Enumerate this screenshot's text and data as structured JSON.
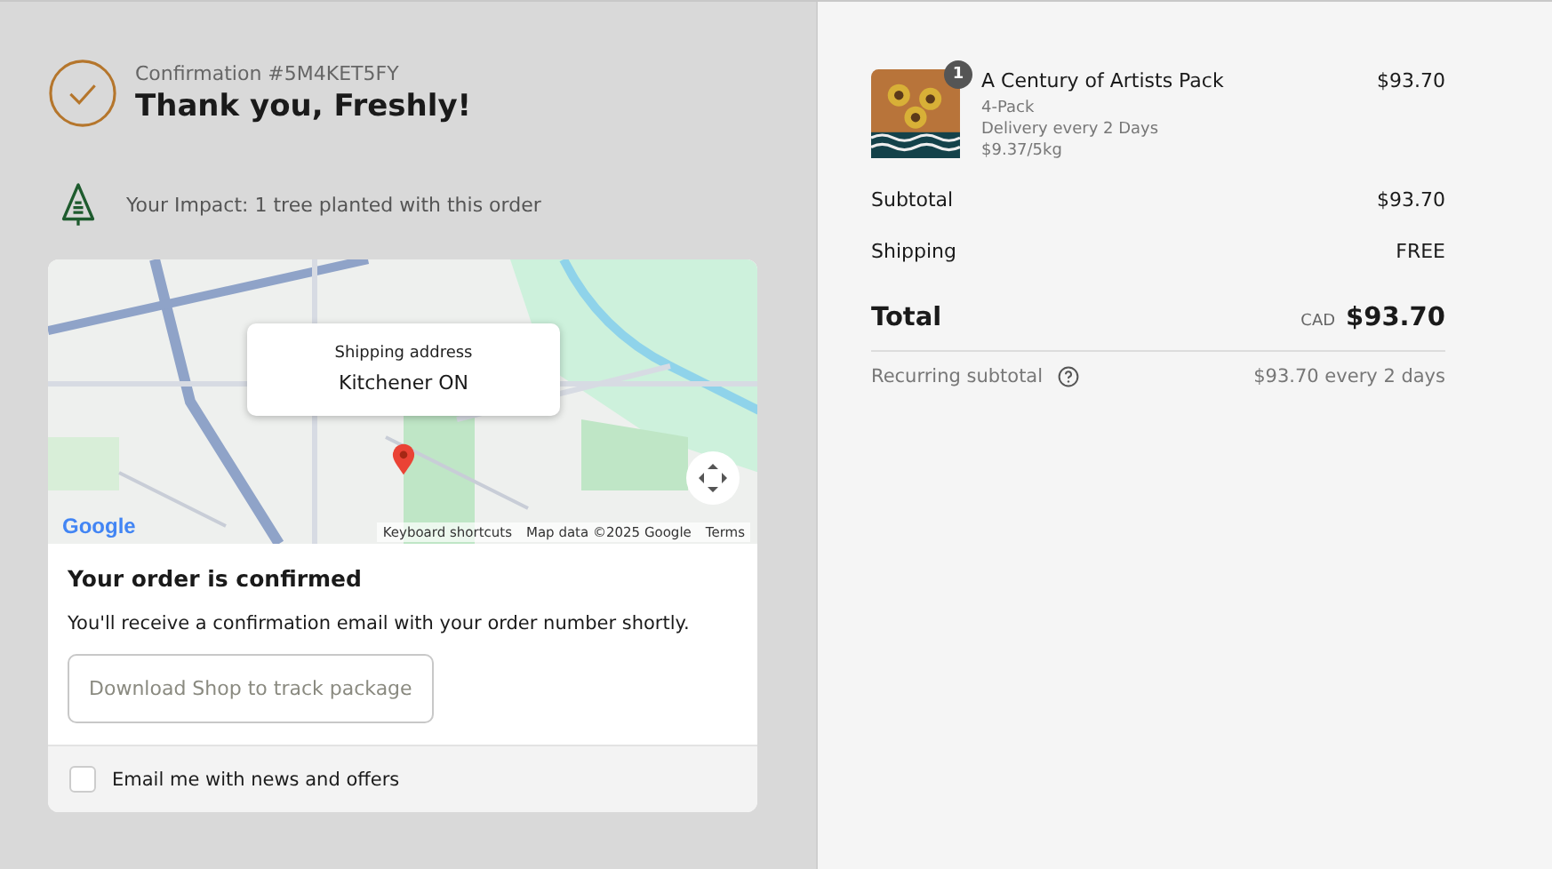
{
  "header": {
    "confirmation": "Confirmation #5M4KET5FY",
    "title": "Thank you, Freshly!"
  },
  "impact": {
    "text": "Your Impact: 1 tree planted with this order"
  },
  "map": {
    "address_label": "Shipping address",
    "address": "Kitchener ON",
    "logo": "Google",
    "attribution": [
      "Keyboard shortcuts",
      "Map data ©2025 Google",
      "Terms"
    ]
  },
  "order_status": {
    "title": "Your order is confirmed",
    "message": "You'll receive a confirmation email with your order number shortly.",
    "button": "Download Shop to track package"
  },
  "newsletter": {
    "label": "Email me with news and offers",
    "checked": false
  },
  "cart": {
    "items": [
      {
        "name": "A Century of Artists Pack",
        "quantity": "1",
        "variant": "4-Pack",
        "delivery": "Delivery every 2 Days",
        "unit_price": "$9.37/5kg",
        "price": "$93.70"
      }
    ],
    "lines": [
      {
        "label": "Subtotal",
        "value": "$93.70"
      },
      {
        "label": "Shipping",
        "value": "FREE"
      }
    ],
    "total": {
      "label": "Total",
      "currency": "CAD",
      "value": "$93.70"
    },
    "recurring": {
      "label": "Recurring subtotal",
      "value": "$93.70 every 2 days"
    }
  }
}
